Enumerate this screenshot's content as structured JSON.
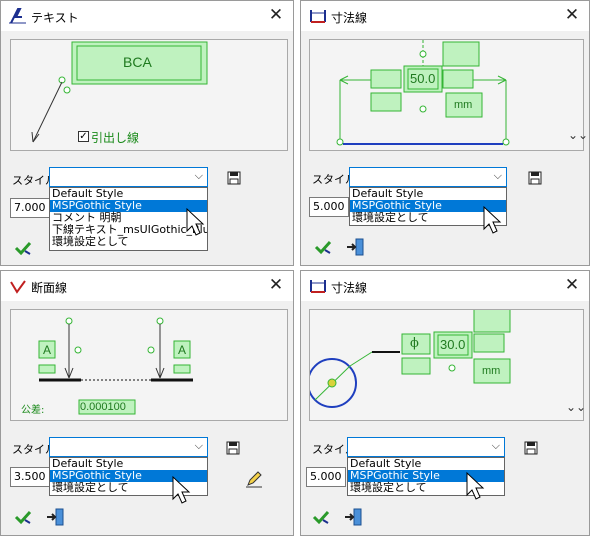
{
  "text_dialog": {
    "title": "テキスト",
    "preview_text": "BCA",
    "leader_checkbox_label": "引出し線",
    "leader_checked": true,
    "style_label": "スタイル:",
    "style_value": "",
    "number_value": "7.000",
    "dropdown_options": [
      "Default Style",
      "MSPGothic Style",
      "コメント 明朝",
      "下線テキスト_msUIGothic_Blue",
      "環境設定として"
    ],
    "selected_index": 1
  },
  "dim_dialog_1": {
    "title": "寸法線",
    "dim_value": "50.0",
    "unit_label": "mm",
    "style_label": "スタイル:",
    "style_value": "",
    "number_value": "5.000",
    "dropdown_options": [
      "Default Style",
      "MSPGothic Style",
      "環境設定として"
    ],
    "selected_index": 1
  },
  "section_dialog": {
    "title": "断面線",
    "label_a_left": "A",
    "label_a_right": "A",
    "tolerance_label": "公差:",
    "tolerance_value": "0.000100",
    "style_label": "スタイル:",
    "style_value": "",
    "number_value": "3.500",
    "dropdown_options": [
      "Default Style",
      "MSPGothic Style",
      "環境設定として"
    ],
    "selected_index": 1
  },
  "dim_dialog_2": {
    "title": "寸法線",
    "phi_symbol": "ϕ",
    "dim_value": "30.0",
    "unit_label": "mm",
    "style_label": "スタイル:",
    "style_value": "",
    "number_value": "5.000",
    "dropdown_options": [
      "Default Style",
      "MSPGothic Style",
      "環境設定として"
    ],
    "selected_index": 1
  },
  "colors": {
    "accent": "#0078d7",
    "green_fill": "#bff2bf",
    "green_line": "#35b535",
    "dim_blue": "#1f3fbf"
  }
}
